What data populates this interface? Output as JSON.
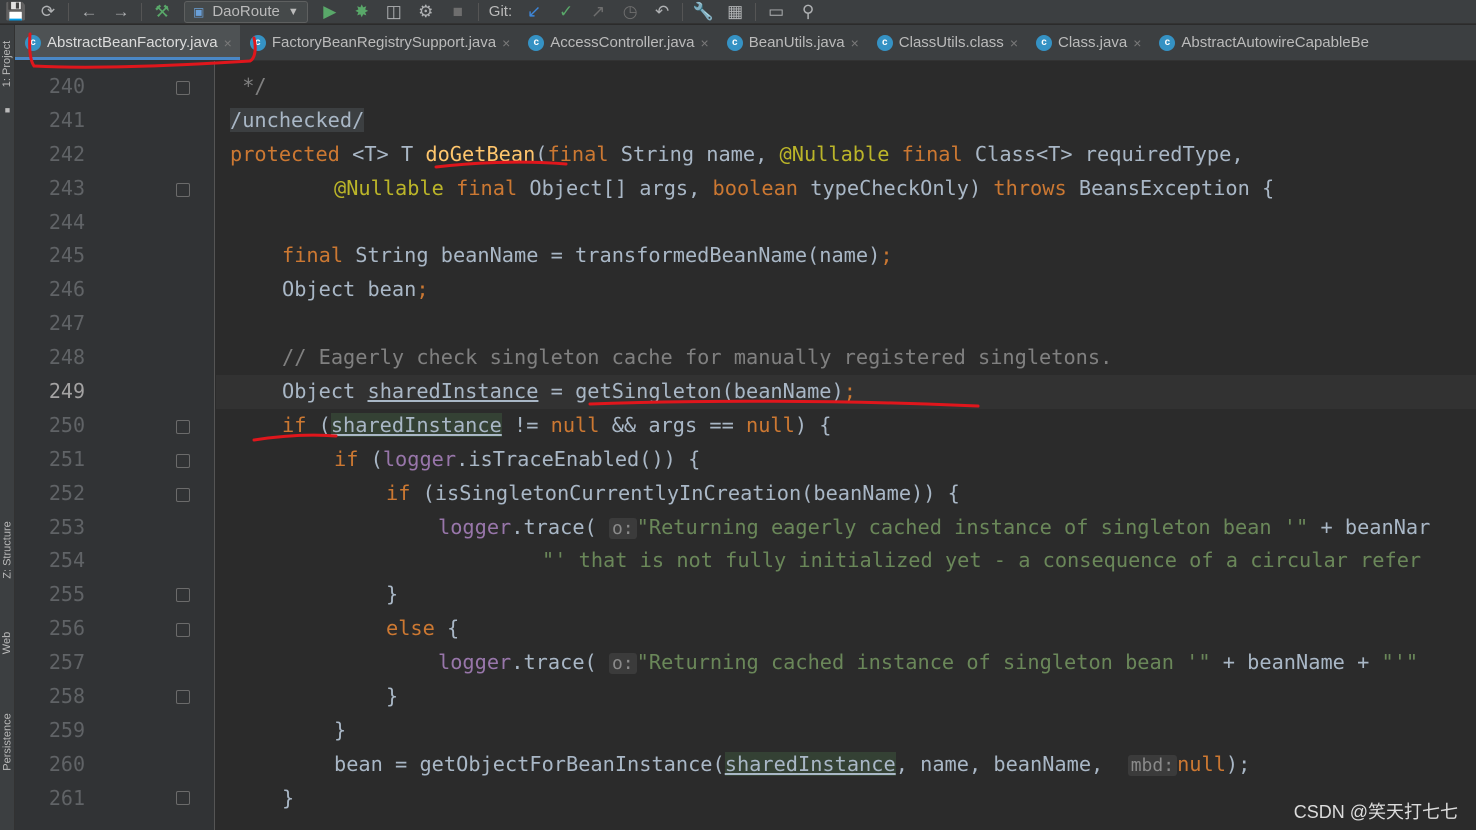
{
  "toolbar": {
    "run_config": "DaoRoute",
    "git_label": "Git:"
  },
  "tabs": [
    {
      "label": "AbstractBeanFactory.java",
      "active": true
    },
    {
      "label": "FactoryBeanRegistrySupport.java",
      "active": false
    },
    {
      "label": "AccessController.java",
      "active": false
    },
    {
      "label": "BeanUtils.java",
      "active": false
    },
    {
      "label": "ClassUtils.class",
      "active": false
    },
    {
      "label": "Class.java",
      "active": false
    },
    {
      "label": "AbstractAutowireCapableBe",
      "active": false
    }
  ],
  "left_strip": {
    "project": "1: Project",
    "structure": "Z: Structure",
    "web": "Web",
    "persistence": "Persistence"
  },
  "line_numbers": [
    "240",
    "241",
    "242",
    "243",
    "244",
    "245",
    "246",
    "247",
    "248",
    "249",
    "250",
    "251",
    "252",
    "253",
    "254",
    "255",
    "256",
    "257",
    "258",
    "259",
    "260",
    "261"
  ],
  "current_line": "249",
  "code": {
    "l240": " */",
    "l241_unchecked": "/unchecked/",
    "l242": {
      "protected": "protected",
      "generic": " <T> T ",
      "method": "doGetBean",
      "open": "(",
      "final1": "final",
      "p1": " String name, ",
      "nullable": "@Nullable",
      "final2": " final",
      "p2": " Class<T> requiredType,"
    },
    "l243": {
      "nullable": "@Nullable",
      "final": " final",
      "p1": " Object[] args, ",
      "boolean": "boolean",
      "p2": " typeCheckOnly) ",
      "throws": "throws",
      "p3": " BeansException {"
    },
    "l245": {
      "final": "final",
      "rest": " String beanName = transformedBeanName(name)",
      "semi": ";"
    },
    "l246": {
      "rest": "Object bean",
      "semi": ";"
    },
    "l248": "// Eagerly check singleton cache for manually registered singletons.",
    "l249": {
      "a": "Object ",
      "var": "sharedInstance",
      "b": " = getSingleton(beanName)",
      "semi": ";"
    },
    "l250": {
      "if": "if",
      "a": " (",
      "var": "sharedInstance",
      "b": " != ",
      "null1": "null",
      "c": " && args == ",
      "null2": "null",
      "d": ") {"
    },
    "l251": {
      "if": "if",
      "a": " (",
      "logger": "logger",
      "b": ".isTraceEnabled()) {"
    },
    "l252": {
      "if": "if",
      "a": " (isSingletonCurrentlyInCreation(beanName)) {"
    },
    "l253": {
      "logger": "logger",
      "a": ".trace(",
      "hint": "o:",
      "str": "\"Returning eagerly cached instance of singleton bean '\"",
      "b": " + beanNar"
    },
    "l254": {
      "str": "\"' that is not fully initialized yet - a consequence of a circular refer"
    },
    "l255": "}",
    "l256": {
      "else": "else",
      "a": " {"
    },
    "l257": {
      "logger": "logger",
      "a": ".trace(",
      "hint": "o:",
      "str": "\"Returning cached instance of singleton bean '\"",
      "b": " + beanName + ",
      "str2": "\"'\""
    },
    "l258": "}",
    "l259": "}",
    "l260": {
      "a": "bean = getObjectForBeanInstance(",
      "var": "sharedInstance",
      "b": ", name, beanName, ",
      "hint": "mbd:",
      "null": "null",
      "c": ");"
    },
    "l261": "}"
  },
  "watermark": "CSDN @笑天打七七",
  "colors": {
    "background": "#2b2b2b",
    "keyword": "#cc7832",
    "annotation": "#bbb529",
    "string": "#6a8759",
    "comment": "#808080",
    "method_decl": "#ffc66d",
    "field": "#9876aa",
    "red_annotation": "#e0161c"
  }
}
